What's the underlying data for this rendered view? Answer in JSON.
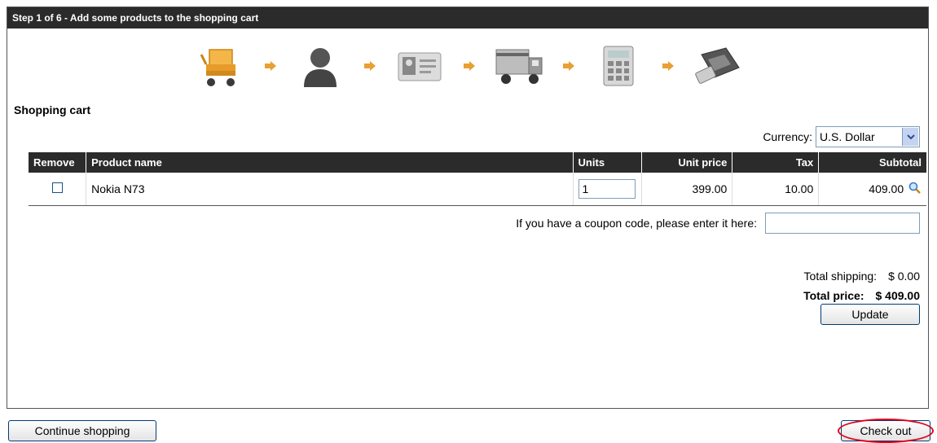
{
  "header": {
    "title": "Step 1 of 6 - Add some products to the shopping cart"
  },
  "steps": [
    {
      "icon": "shopping-cart-icon"
    },
    {
      "icon": "user-icon"
    },
    {
      "icon": "id-card-icon"
    },
    {
      "icon": "delivery-truck-icon"
    },
    {
      "icon": "calculator-icon"
    },
    {
      "icon": "card-reader-icon"
    }
  ],
  "cart": {
    "title": "Shopping cart",
    "currency_label": "Currency:",
    "currency_value": "U.S. Dollar",
    "columns": {
      "remove": "Remove",
      "product": "Product name",
      "units": "Units",
      "unit_price": "Unit price",
      "tax": "Tax",
      "subtotal": "Subtotal"
    },
    "rows": [
      {
        "product": "Nokia N73",
        "units": "1",
        "unit_price": "399.00",
        "tax": "10.00",
        "subtotal": "409.00"
      }
    ],
    "coupon_label": "If you have a coupon code, please enter it here:",
    "coupon_value": "",
    "shipping_label": "Total shipping:",
    "shipping_value": "$ 0.00",
    "total_label": "Total price:",
    "total_value": "$ 409.00",
    "update_label": "Update"
  },
  "footer": {
    "continue_label": "Continue shopping",
    "checkout_label": "Check out"
  },
  "colors": {
    "header_bg": "#2b2b2b",
    "arrow": "#e8a033",
    "highlight_ring": "#e0001b"
  }
}
